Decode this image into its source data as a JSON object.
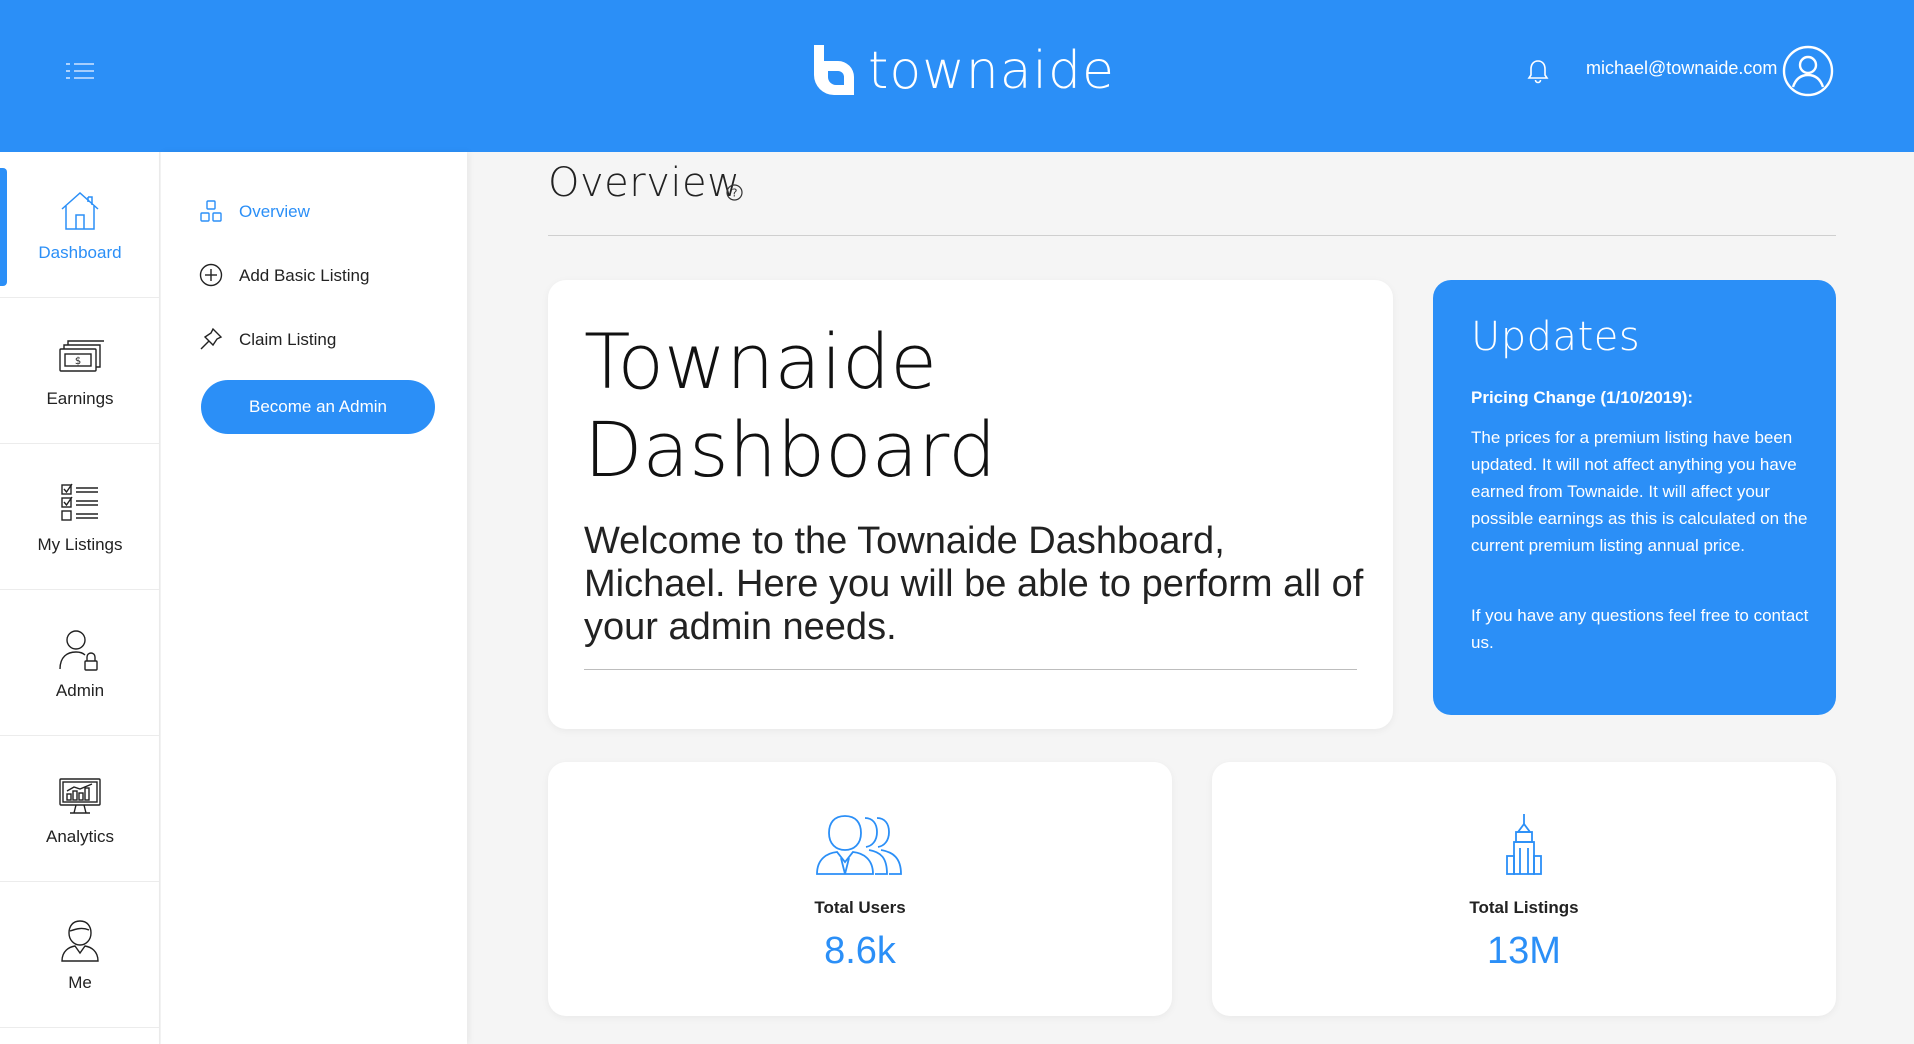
{
  "header": {
    "brand": "townaide",
    "user_email": "michael@townaide.com"
  },
  "rail": {
    "items": [
      {
        "label": "Dashboard",
        "icon": "house-icon"
      },
      {
        "label": "Earnings",
        "icon": "money-stack-icon"
      },
      {
        "label": "My Listings",
        "icon": "checklist-icon"
      },
      {
        "label": "Admin",
        "icon": "person-lock-icon"
      },
      {
        "label": "Analytics",
        "icon": "monitor-chart-icon"
      },
      {
        "label": "Me",
        "icon": "person-icon"
      }
    ]
  },
  "submenu": {
    "items": [
      {
        "label": "Overview",
        "icon": "blocks-icon"
      },
      {
        "label": "Add Basic Listing",
        "icon": "plus-circle-icon"
      },
      {
        "label": "Claim Listing",
        "icon": "pin-icon"
      }
    ],
    "admin_button": "Become an Admin"
  },
  "main": {
    "title": "Overview",
    "hero": {
      "title": "Townaide Dashboard",
      "text": "Welcome to the Townaide Dashboard, Michael. Here you will be able to perform all of your admin needs."
    },
    "updates": {
      "title": "Updates",
      "subtitle": "Pricing Change (1/10/2019):",
      "body": "The prices for a premium listing have been updated. It will not affect anything you have earned from Townaide. It will affect your possible earnings as this is calculated on the current premium listing annual price.",
      "footer": "If you have any questions feel free to contact us."
    },
    "stats": [
      {
        "label": "Total Users",
        "value": "8.6k",
        "icon": "users-icon"
      },
      {
        "label": "Total Listings",
        "value": "13M",
        "icon": "building-icon"
      }
    ]
  },
  "colors": {
    "accent": "#2b8ff7",
    "background": "#f5f5f5",
    "card": "#ffffff"
  }
}
